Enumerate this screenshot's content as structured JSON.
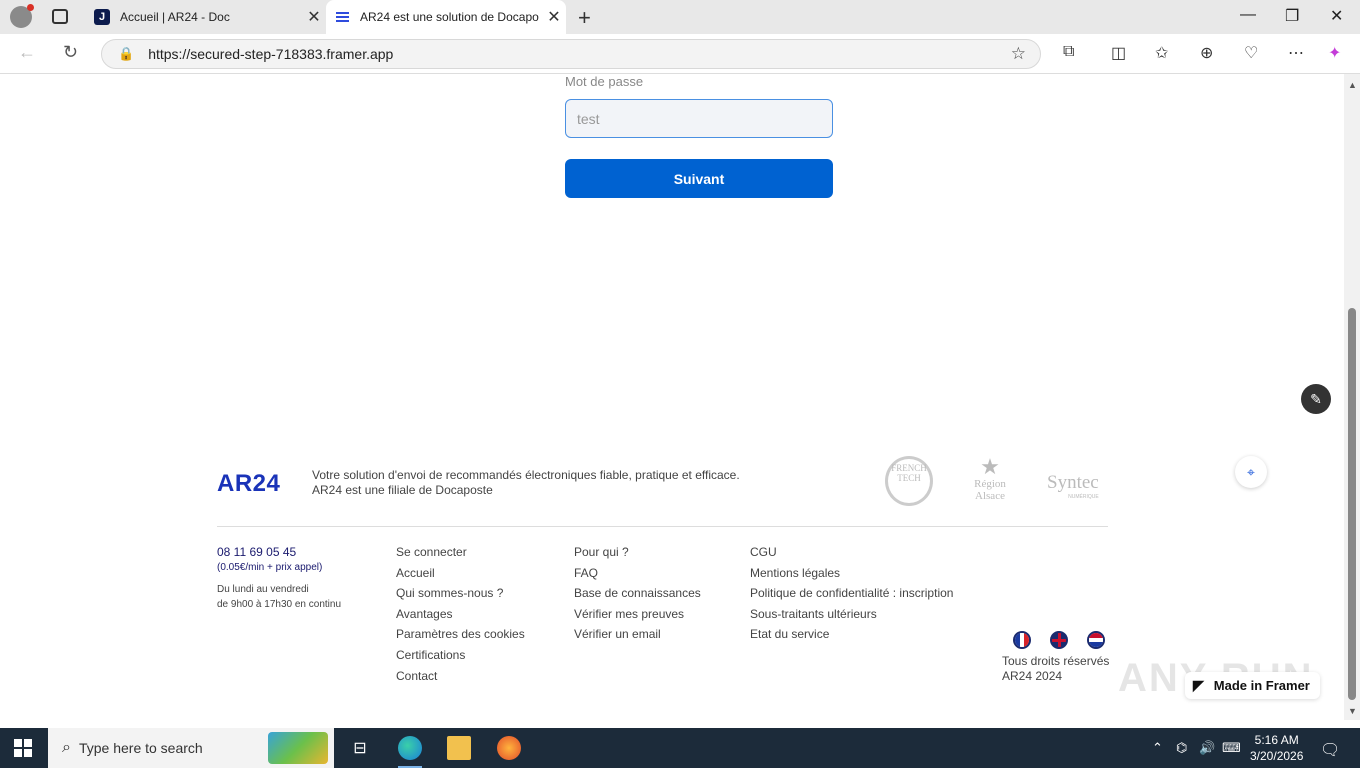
{
  "browser": {
    "tabs": [
      {
        "title": "Accueil | AR24 - Doc",
        "icon": "j-logo-icon"
      },
      {
        "title": "AR24 est une solution de Docapo",
        "icon": "docaposte-lines-icon"
      }
    ],
    "url": "https://secured-step-718383.framer.app"
  },
  "form": {
    "password_label": "Mot de passe",
    "password_value": "test",
    "next_label": "Suivant"
  },
  "footer": {
    "logo": "AR24",
    "tagline_line1": "Votre solution d'envoi de recommandés électroniques fiable, pratique et efficace.",
    "tagline_line2": "AR24 est une filiale de Docaposte",
    "badges": {
      "frenchtech": "FRENCH TECH",
      "region_line1": "Région",
      "region_line2": "Alsace",
      "syntec": "Syntec",
      "syntec_sub": "NUMÉRIQUE"
    },
    "phone": "08 11 69 05 45",
    "phone_note": "(0.05€/min + prix appel)",
    "hours_line1": "Du lundi au vendredi",
    "hours_line2": "de 9h00 à 17h30 en continu",
    "col1": [
      "Se connecter",
      "Accueil",
      "Qui sommes-nous ?",
      "Avantages",
      "Paramètres des cookies",
      "Certifications",
      "Contact"
    ],
    "col2": [
      "Pour qui ?",
      "FAQ",
      "Base de connaissances",
      "Vérifier mes preuves",
      "Vérifier un email"
    ],
    "col3": [
      "CGU",
      "Mentions légales",
      "Politique de confidentialité : inscription",
      "Sous-traitants ultérieurs",
      "Etat du service"
    ],
    "rights_line1": "Tous droits réservés",
    "rights_line2": "AR24 2024",
    "made_in_framer": "Made in Framer",
    "watermark": "ANY RUN"
  },
  "taskbar": {
    "search_placeholder": "Type here to search",
    "time": "5:16 AM",
    "date": "3/20/2026"
  },
  "colors": {
    "primary_button": "#0062d1",
    "logo": "#1a33b8",
    "taskbar": "#1c2b3a"
  }
}
